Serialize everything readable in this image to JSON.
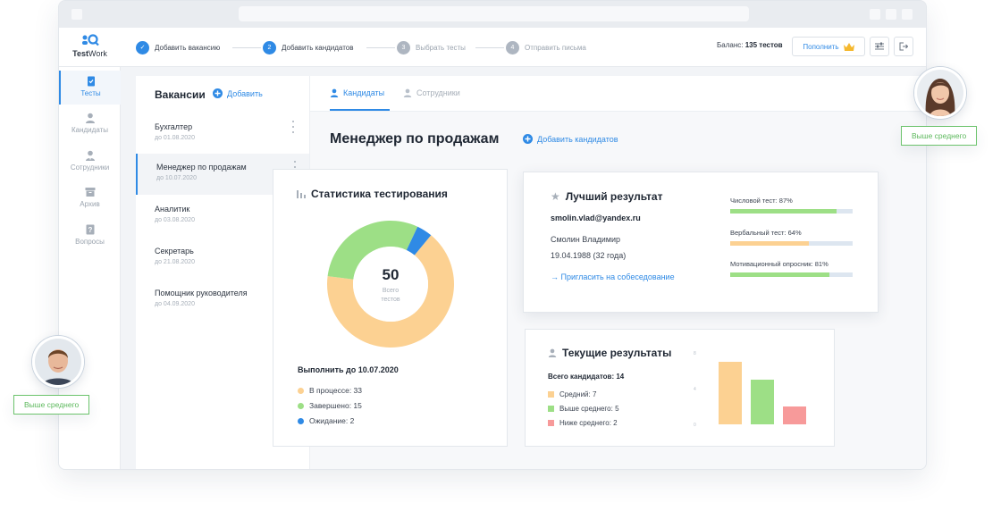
{
  "app": {
    "logo_main": "Test",
    "logo_sub": "Work"
  },
  "steps": [
    {
      "num": "✓",
      "label": "Добавить вакансию"
    },
    {
      "num": "2",
      "label": "Добавить кандидатов"
    },
    {
      "num": "3",
      "label": "Выбрать тесты"
    },
    {
      "num": "4",
      "label": "Отправить письма"
    }
  ],
  "header": {
    "balance_label": "Баланс:",
    "balance_value": "135 тестов",
    "topup_label": "Пополнить"
  },
  "sidebar": {
    "items": [
      {
        "label": "Тесты"
      },
      {
        "label": "Кандидаты"
      },
      {
        "label": "Сотрудники"
      },
      {
        "label": "Архив"
      },
      {
        "label": "Вопросы"
      }
    ]
  },
  "vacancies": {
    "title": "Вакансии",
    "add_label": "Добавить",
    "items": [
      {
        "name": "Бухгалтер",
        "date": "до 01.08.2020"
      },
      {
        "name": "Менеджер по продажам",
        "date": "до 10.07.2020"
      },
      {
        "name": "Аналитик",
        "date": "до 03.08.2020"
      },
      {
        "name": "Секретарь",
        "date": "до 21.08.2020"
      },
      {
        "name": "Помощник руководителя",
        "date": "до 04.09.2020"
      }
    ]
  },
  "tabs": [
    {
      "label": "Кандидаты"
    },
    {
      "label": "Сотрудники"
    }
  ],
  "main": {
    "title": "Менеджер по продажам",
    "add_candidates": "Добавить кандидатов"
  },
  "stats": {
    "title": "Статистика тестирования",
    "total": "50",
    "total_caption_1": "Всего",
    "total_caption_2": "тестов",
    "deadline": "Выполнить до 10.07.2020",
    "legend": [
      {
        "label": "В процессе: 33",
        "value": 33,
        "color": "#fcd192"
      },
      {
        "label": "Завершено: 15",
        "value": 15,
        "color": "#9ddf86"
      },
      {
        "label": "Ожидание: 2",
        "value": 2,
        "color": "#2f8ae5"
      }
    ]
  },
  "best": {
    "title": "Лучший результат",
    "email": "smolin.vlad@yandex.ru",
    "name": "Смолин Владимир",
    "dob": "19.04.1988 (32 года)",
    "invite": "→ Пригласить на собеседование",
    "bars": [
      {
        "label": "Числовой тест: 87%",
        "percent": 87,
        "color": "#9ddf86"
      },
      {
        "label": "Вербальный тест: 64%",
        "percent": 64,
        "color": "#fcd192"
      },
      {
        "label": "Мотивационный опросник: 81%",
        "percent": 81,
        "color": "#9ddf86"
      }
    ]
  },
  "current": {
    "title": "Текущие результаты",
    "total": "Всего кандидатов: 14",
    "legend": [
      {
        "label": "Средний: 7",
        "color": "#fcd192"
      },
      {
        "label": "Выше среднего: 5",
        "color": "#9ddf86"
      },
      {
        "label": "Ниже среднего: 2",
        "color": "#f79a9a"
      }
    ]
  },
  "badges": {
    "right": "Выше среднего",
    "left": "Выше среднего"
  },
  "chart_data": [
    {
      "type": "pie",
      "categories": [
        "В процессе",
        "Завершено",
        "Ожидание"
      ],
      "values": [
        33,
        15,
        2
      ],
      "colors": [
        "#fcd192",
        "#9ddf86",
        "#2f8ae5"
      ],
      "title": "Статистика тестирования"
    },
    {
      "type": "bar",
      "categories": [
        "Средний",
        "Выше среднего",
        "Ниже среднего"
      ],
      "values": [
        7,
        5,
        2
      ],
      "colors": [
        "#fcd192",
        "#9ddf86",
        "#f79a9a"
      ],
      "ylim": [
        0,
        8
      ],
      "yticks": [
        "8",
        "4",
        "0"
      ],
      "title": "Текущие результаты"
    }
  ]
}
